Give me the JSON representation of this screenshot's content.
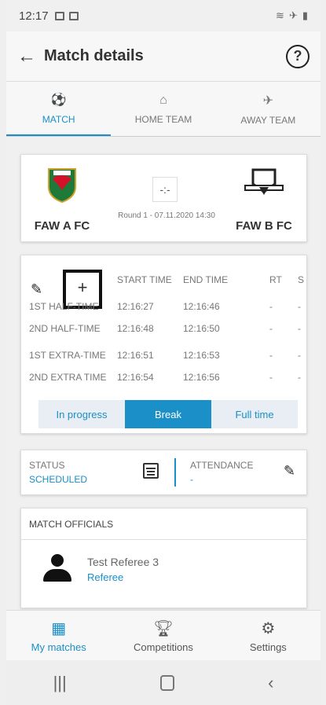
{
  "status_bar": {
    "time": "12:17"
  },
  "header": {
    "title": "Match details",
    "help": "?"
  },
  "tabs": [
    {
      "label": "MATCH",
      "icon": "soccer-ball-icon"
    },
    {
      "label": "HOME TEAM",
      "icon": "home-icon"
    },
    {
      "label": "AWAY TEAM",
      "icon": "airplane-icon"
    }
  ],
  "match": {
    "home_team": "FAW A FC",
    "away_team": "FAW B FC",
    "score": "-:-",
    "round": "Round 1 - 07.11.2020 14:30"
  },
  "times": {
    "add": "+",
    "headers": {
      "start": "START TIME",
      "end": "END TIME",
      "rt": "RT",
      "s": "S"
    },
    "rows": [
      {
        "name": "1ST HALF-TIME",
        "start": "12:16:27",
        "end": "12:16:46",
        "rt": "-",
        "s": "-"
      },
      {
        "name": "2ND HALF-TIME",
        "start": "12:16:48",
        "end": "12:16:50",
        "rt": "-",
        "s": "-"
      },
      {
        "name": "1ST EXTRA-TIME",
        "start": "12:16:51",
        "end": "12:16:53",
        "rt": "-",
        "s": "-"
      },
      {
        "name": "2ND EXTRA TIME",
        "start": "12:16:54",
        "end": "12:16:56",
        "rt": "-",
        "s": "-"
      }
    ],
    "states": [
      "In progress",
      "Break",
      "Full time"
    ],
    "active_state": "Break"
  },
  "status": {
    "label": "STATUS",
    "value": "SCHEDULED",
    "attendance_label": "ATTENDANCE",
    "attendance_value": "-"
  },
  "officials": {
    "heading": "MATCH OFFICIALS",
    "items": [
      {
        "name": "Test Referee 3",
        "role": "Referee"
      }
    ]
  },
  "bottom_nav": [
    {
      "label": "My matches",
      "icon": "calendar-grid-icon"
    },
    {
      "label": "Competitions",
      "icon": "trophy-icon"
    },
    {
      "label": "Settings",
      "icon": "gear-icon"
    }
  ],
  "colors": {
    "accent": "#1a8fc8"
  }
}
